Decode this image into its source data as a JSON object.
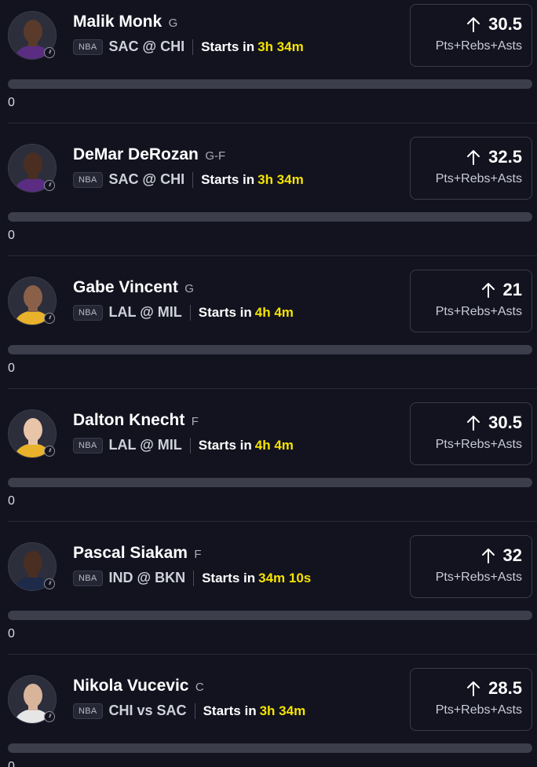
{
  "colors": {
    "background": "#12131f",
    "accent_time": "#f5e300",
    "card_border": "#3a3c4a",
    "progress_track": "#3c3e4c"
  },
  "players": [
    {
      "name": "Malik Monk",
      "position": "G",
      "league": "NBA",
      "matchup": "SAC @ CHI",
      "starts_label": "Starts in",
      "starts_time": "3h 34m",
      "direction_icon": "arrow-up-icon",
      "line": "30.5",
      "stat": "Pts+Rebs+Asts",
      "progress": 0,
      "progress_text": "0",
      "jersey_color": "#5a2d82",
      "skin": "#5a3a2a"
    },
    {
      "name": "DeMar DeRozan",
      "position": "G-F",
      "league": "NBA",
      "matchup": "SAC @ CHI",
      "starts_label": "Starts in",
      "starts_time": "3h 34m",
      "direction_icon": "arrow-up-icon",
      "line": "32.5",
      "stat": "Pts+Rebs+Asts",
      "progress": 0,
      "progress_text": "0",
      "jersey_color": "#5a2d82",
      "skin": "#4a2e22"
    },
    {
      "name": "Gabe Vincent",
      "position": "G",
      "league": "NBA",
      "matchup": "LAL @ MIL",
      "starts_label": "Starts in",
      "starts_time": "4h 4m",
      "direction_icon": "arrow-up-icon",
      "line": "21",
      "stat": "Pts+Rebs+Asts",
      "progress": 0,
      "progress_text": "0",
      "jersey_color": "#e8b22a",
      "skin": "#8a6048"
    },
    {
      "name": "Dalton Knecht",
      "position": "F",
      "league": "NBA",
      "matchup": "LAL @ MIL",
      "starts_label": "Starts in",
      "starts_time": "4h 4m",
      "direction_icon": "arrow-up-icon",
      "line": "30.5",
      "stat": "Pts+Rebs+Asts",
      "progress": 0,
      "progress_text": "0",
      "jersey_color": "#e8b22a",
      "skin": "#e8c4a8"
    },
    {
      "name": "Pascal Siakam",
      "position": "F",
      "league": "NBA",
      "matchup": "IND @ BKN",
      "starts_label": "Starts in",
      "starts_time": "34m 10s",
      "direction_icon": "arrow-up-icon",
      "line": "32",
      "stat": "Pts+Rebs+Asts",
      "progress": 0,
      "progress_text": "0",
      "jersey_color": "#1e2a4a",
      "skin": "#4a2e22"
    },
    {
      "name": "Nikola Vucevic",
      "position": "C",
      "league": "NBA",
      "matchup": "CHI vs SAC",
      "starts_label": "Starts in",
      "starts_time": "3h 34m",
      "direction_icon": "arrow-up-icon",
      "line": "28.5",
      "stat": "Pts+Rebs+Asts",
      "progress": 0,
      "progress_text": "0",
      "jersey_color": "#e6e6e6",
      "skin": "#d8b49a"
    }
  ]
}
